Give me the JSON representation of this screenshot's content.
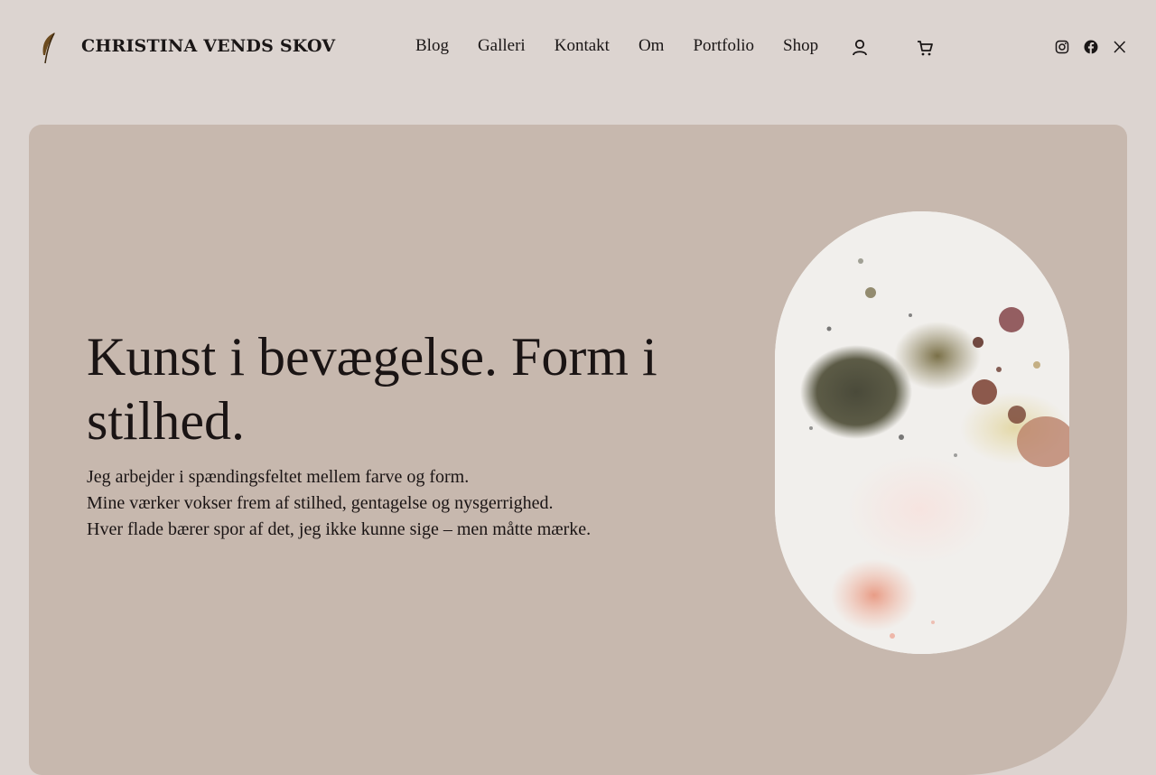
{
  "site": {
    "title": "CHRISTINA VENDS SKOV",
    "logo_icon": "feather-icon"
  },
  "nav": {
    "items": [
      {
        "label": "Blog"
      },
      {
        "label": "Galleri"
      },
      {
        "label": "Kontakt"
      },
      {
        "label": "Om"
      },
      {
        "label": "Portfolio"
      },
      {
        "label": "Shop"
      }
    ]
  },
  "header_icons": {
    "account": "account-icon",
    "cart": "cart-icon"
  },
  "social": [
    "instagram-icon",
    "facebook-icon",
    "x-icon"
  ],
  "hero": {
    "headline": "Kunst i bevægelse. Form i stilhed.",
    "lines": [
      "Jeg arbejder i spændingsfeltet mellem farve og form.",
      "Mine værker vokser frem af stilhed, gentagelse og nysgerrighed.",
      "Hver flade bærer spor af det, jeg ikke kunne sige – men måtte mærke."
    ]
  },
  "colors": {
    "page_bg": "#dcd4d0",
    "hero_bg": "#c7b8ae",
    "text": "#1a1616",
    "logo": "#6b4a1e"
  }
}
